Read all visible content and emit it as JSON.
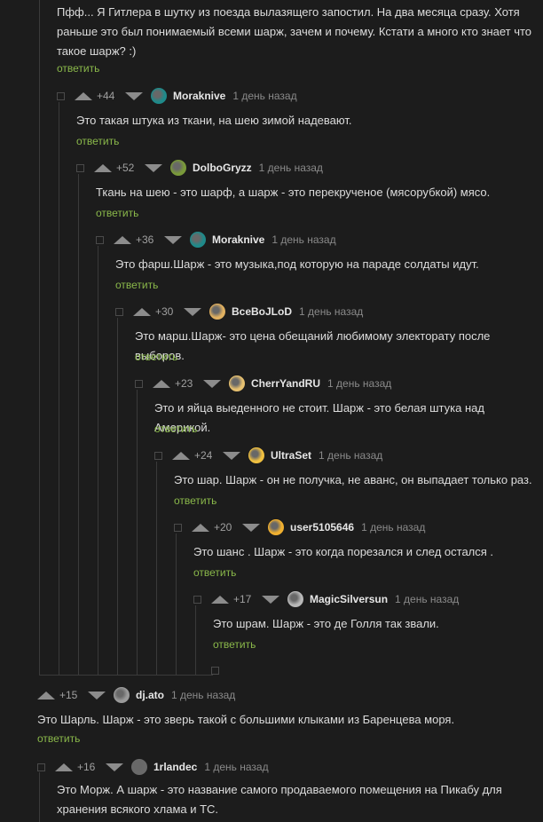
{
  "reply_label": "ответить",
  "top_comment": {
    "text": "Пфф... Я Гитлера в шутку из поезда вылазящего запостил. На два месяца сразу. Хотя раньше это был понимаемый всеми шарж, зачем и почему. Кстати а много кто знает что такое шарж? :)"
  },
  "comments": [
    {
      "rating": "+44",
      "user": "Moraknive",
      "time": "1 день назад",
      "text": "Это такая штука из ткани, на шею зимой надевают.",
      "avatar_color": "#1f8a8a"
    },
    {
      "rating": "+52",
      "user": "DolboGryzz",
      "time": "1 день назад",
      "text": "Ткань на шею - это шарф, а шарж - это перекрученое (мясорубкой) мясо.",
      "avatar_color": "#7a9a3a"
    },
    {
      "rating": "+36",
      "user": "Moraknive",
      "time": "1 день назад",
      "text": "Это фарш.Шарж - это музыка,под которую на параде солдаты идут.",
      "avatar_color": "#1f8a8a"
    },
    {
      "rating": "+30",
      "user": "BceBoJLoD",
      "time": "1 день назад",
      "text": "Это марш.Шарж- это цена обещаний любимому электорату после выборов.",
      "avatar_color": "#e0b060"
    },
    {
      "rating": "+23",
      "user": "CherrYandRU",
      "time": "1 день назад",
      "text": "Это и яйца выеденного не стоит. Шарж - это белая штука над Америкой.",
      "avatar_color": "#e6c070"
    },
    {
      "rating": "+24",
      "user": "UltraSet",
      "time": "1 день назад",
      "text": "Это шар. Шарж - он не получка, не аванс, он выпадает только раз.",
      "avatar_color": "#f0c040"
    },
    {
      "rating": "+20",
      "user": "user5105646",
      "time": "1 день назад",
      "text": "Это шанс . Шарж - это когда порезался и след остался .",
      "avatar_color": "#f0b030"
    },
    {
      "rating": "+17",
      "user": "MagicSilversun",
      "time": "1 день назад",
      "text": "Это шрам. Шарж - это де Голля так звали.",
      "avatar_color": "#b8b8b8"
    },
    {
      "rating": "+15",
      "user": "dj.ato",
      "time": "1 день назад",
      "text": "Это Шарль. Шарж - это зверь такой с большими клыками из Баренцева моря.",
      "avatar_color": "#9a9a9a"
    },
    {
      "rating": "+16",
      "user": "1rlandec",
      "time": "1 день назад",
      "text": "Это Морж. А шарж - это название самого продаваемого помещения на Пикабу для хранения всякого хлама и ТС.",
      "avatar_color": "#6a6a6a"
    }
  ]
}
